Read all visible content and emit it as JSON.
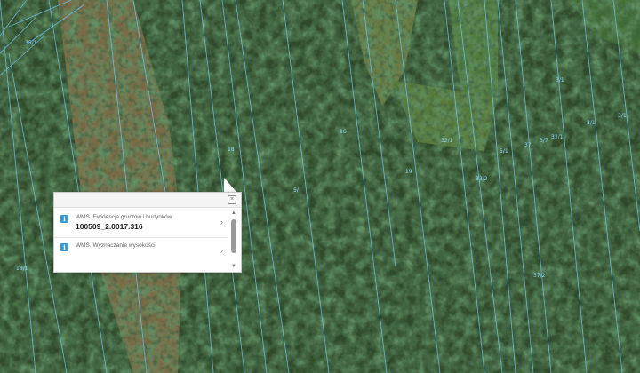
{
  "map": {
    "parcel_labels": [
      "35/1",
      "18",
      "16",
      "5/",
      "32/1",
      "19",
      "37",
      "5/1",
      "3/7",
      "33/1",
      "33/2",
      "3/1",
      "3/1",
      "3/1",
      "37/2",
      "18/1"
    ]
  },
  "popup": {
    "items": [
      {
        "layer": "WMS. Ewidencja gruntów i budynków",
        "value": "100509_2.0017.316"
      },
      {
        "layer": "WMS. Wyznaczanie wysokości",
        "value": ""
      }
    ],
    "close_label": "×",
    "scroll_up": "▲",
    "scroll_down": "▼",
    "info_glyph": "i",
    "chevron": "›"
  }
}
